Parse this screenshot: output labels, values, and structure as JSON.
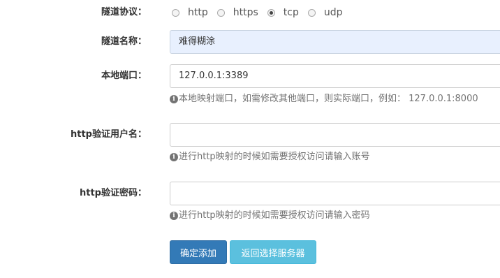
{
  "form": {
    "protocol": {
      "label": "隧道协议：",
      "options": [
        {
          "label": "http",
          "checked": false
        },
        {
          "label": "https",
          "checked": false
        },
        {
          "label": "tcp",
          "checked": true
        },
        {
          "label": "udp",
          "checked": false
        }
      ]
    },
    "tunnel_name": {
      "label": "隧道名称：",
      "value": "难得糊涂"
    },
    "local_port": {
      "label": "本地端口：",
      "value": "127.0.0.1:3389",
      "help": "本地映射端口，如需修改其他端口，则实际端口，例如： 127.0.0.1:8000"
    },
    "http_user": {
      "label": "http验证用户名：",
      "value": "",
      "help": "进行http映射的时候如需要授权访问请输入账号"
    },
    "http_password": {
      "label": "http验证密码：",
      "value": "",
      "help": "进行http映射的时候如需要授权访问请输入密码"
    },
    "buttons": {
      "confirm": "确定添加",
      "back": "返回选择服务器"
    },
    "icons": {
      "help": "info-circle-icon"
    },
    "colors": {
      "primary": "#337ab7",
      "info": "#5bc0de",
      "autofill": "#e8f0fe"
    }
  }
}
